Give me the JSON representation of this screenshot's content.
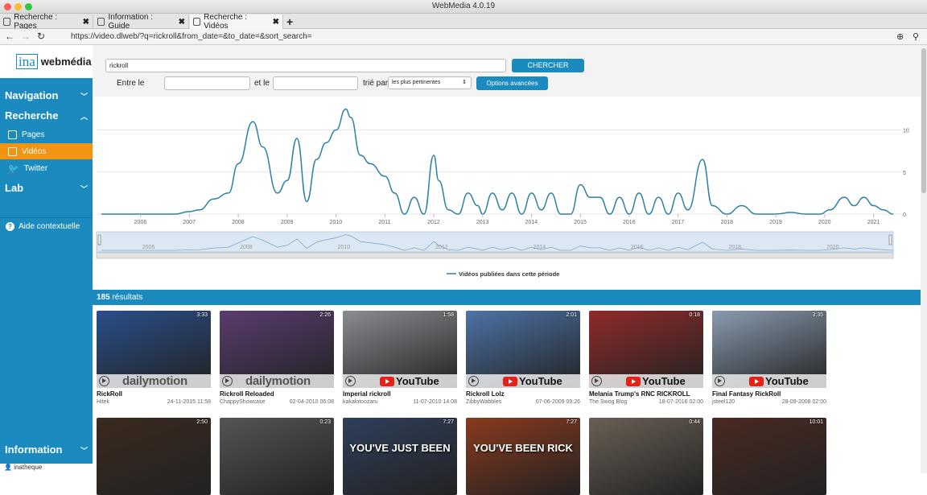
{
  "window": {
    "title": "WebMedia 4.0.19"
  },
  "tabs": [
    {
      "label": "Recherche : Pages",
      "active": false
    },
    {
      "label": "Information : Guide",
      "active": false
    },
    {
      "label": "Recherche : Vidéos",
      "active": true
    }
  ],
  "browser": {
    "url": "https://video.dlweb/?q=rickroll&from_date=&to_date=&sort_search="
  },
  "sidebar": {
    "logo_ina": "ina",
    "logo_text": "webmédia",
    "logo_slash": "/",
    "navigation": "Navigation",
    "recherche": "Recherche",
    "items": [
      {
        "label": "Pages"
      },
      {
        "label": "Vidéos"
      },
      {
        "label": "Twitter"
      }
    ],
    "lab": "Lab",
    "help": "Aide contextuelle",
    "information": "Information",
    "user": "inatheque"
  },
  "search": {
    "query": "rickroll",
    "button": "CHERCHER",
    "between_label": "Entre le",
    "and_label": "et le",
    "sort_label": "trié par",
    "sort_value": "les plus pertinentes",
    "advanced": "Options avancées"
  },
  "chart_data": {
    "type": "line",
    "x_ticks": [
      "2006",
      "2007",
      "2008",
      "2009",
      "2010",
      "2011",
      "2012",
      "2013",
      "2014",
      "2015",
      "2016",
      "2017",
      "2018",
      "2019",
      "2020",
      "2021"
    ],
    "y_ticks": [
      0,
      5,
      10
    ],
    "navigator_ticks": [
      "2006",
      "2008",
      "2010",
      "2012",
      "2014",
      "2016",
      "2018",
      "2020"
    ],
    "legend": "Vidéos publiées dans cette période",
    "color": "#2e7fa8",
    "series": [
      {
        "name": "Vidéos publiées dans cette période",
        "x": [
          2005.2,
          2006.0,
          2006.7,
          2007.0,
          2007.2,
          2007.5,
          2007.8,
          2008.0,
          2008.3,
          2008.5,
          2008.8,
          2009.0,
          2009.2,
          2009.4,
          2009.6,
          2009.8,
          2010.0,
          2010.2,
          2010.3,
          2010.5,
          2010.7,
          2011.0,
          2011.2,
          2011.4,
          2011.6,
          2011.8,
          2012.0,
          2012.1,
          2012.3,
          2012.5,
          2012.7,
          2012.9,
          2013.0,
          2013.2,
          2013.4,
          2013.6,
          2013.8,
          2014.0,
          2014.2,
          2014.4,
          2014.6,
          2014.8,
          2015.0,
          2015.2,
          2015.4,
          2015.6,
          2015.8,
          2016.0,
          2016.2,
          2016.4,
          2016.6,
          2016.8,
          2017.0,
          2017.2,
          2017.5,
          2017.7,
          2018.0,
          2018.3,
          2018.6,
          2019.0,
          2019.3,
          2019.6,
          2019.9,
          2020.1,
          2020.4,
          2020.6,
          2020.8,
          2021.0,
          2021.2,
          2021.4
        ],
        "y": [
          0,
          0,
          0,
          0.3,
          0.5,
          1.8,
          2.5,
          6,
          11,
          8,
          2.5,
          4,
          9,
          1.5,
          6.5,
          8.5,
          10,
          12.5,
          11.5,
          7,
          6,
          4.5,
          2.5,
          0,
          2,
          0,
          7,
          4,
          0.5,
          0,
          2.5,
          1,
          0,
          2.5,
          0.5,
          2.5,
          0,
          2.5,
          0.5,
          2.5,
          0,
          0,
          3.5,
          2,
          2,
          0,
          2,
          0,
          2.5,
          0,
          2,
          0,
          2.5,
          0.5,
          6.5,
          1,
          0,
          1,
          0,
          0,
          0.2,
          0,
          0,
          0.5,
          2,
          1,
          2,
          1,
          0.5,
          0
        ]
      }
    ],
    "xlim": [
      2005.1,
      2021.4
    ],
    "ylim": [
      0,
      13.5
    ]
  },
  "results": {
    "count": "185",
    "label": "résultats"
  },
  "videos": [
    {
      "title": "RickRoll",
      "author": "Hitek",
      "date": "24-11-2015 11:58",
      "duration": "3:33",
      "source": "dailymotion",
      "bg": "#2a4f8a"
    },
    {
      "title": "Rickroll Reloaded",
      "author": "ChappyShowcase",
      "date": "02-04-2010 06:08",
      "duration": "2:26",
      "source": "dailymotion",
      "bg": "#5a3d70"
    },
    {
      "title": "Imperial rickroll",
      "author": "kakalotoozaru",
      "date": "11-07-2010 14:08",
      "duration": "1:58",
      "source": "YouTube",
      "bg": "#8a8d92"
    },
    {
      "title": "Rickroll Lolz",
      "author": "ZibbyWabbles",
      "date": "07-06-2009 09:26",
      "duration": "2:01",
      "source": "YouTube",
      "bg": "#4d73a6"
    },
    {
      "title": "Melania Trump's RNC RICKROLL",
      "author": "The Swog Blog",
      "date": "18-07-2016 02:00",
      "duration": "0:18",
      "source": "YouTube",
      "bg": "#8f2b2b"
    },
    {
      "title": "Final Fantasy RickRoll",
      "author": "jsteel120",
      "date": "28-09-2008 02:00",
      "duration": "3:35",
      "source": "YouTube",
      "bg": "#8a9bb0"
    },
    {
      "title": "",
      "author": "",
      "date": "",
      "duration": "2:50",
      "source": "",
      "bg": "#3b2a1f"
    },
    {
      "title": "",
      "author": "",
      "date": "",
      "duration": "0:23",
      "source": "",
      "bg": "#555555"
    },
    {
      "title": "",
      "author": "",
      "date": "",
      "duration": "7:27",
      "source": "",
      "caption": "YOU'VE JUST BEEN",
      "bg": "#2f3f5a"
    },
    {
      "title": "",
      "author": "",
      "date": "",
      "duration": "7:27",
      "source": "",
      "caption": "YOU'VE BEEN RICK",
      "bg": "#8a3a1e"
    },
    {
      "title": "",
      "author": "",
      "date": "",
      "duration": "0:44",
      "source": "",
      "bg": "#6a6055"
    },
    {
      "title": "",
      "author": "",
      "date": "",
      "duration": "10:01",
      "source": "",
      "bg": "#4a2a22"
    }
  ]
}
